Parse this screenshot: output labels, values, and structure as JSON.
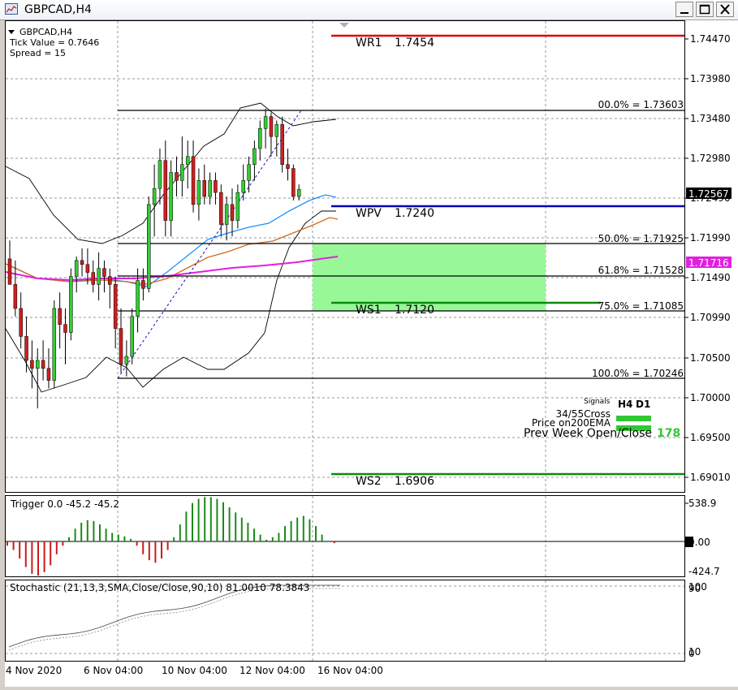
{
  "window": {
    "title": "GBPCAD,H4"
  },
  "info": {
    "symbol": "GBPCAD,H4",
    "tick_value": "Tick Value = 0.7646",
    "spread": "Spread = 15"
  },
  "price_axis": [
    "1.74470",
    "1.73980",
    "1.73480",
    "1.72980",
    "1.72490",
    "1.71990",
    "1.71490",
    "1.70990",
    "1.70500",
    "1.70000",
    "1.69500",
    "1.69010"
  ],
  "price_markers": {
    "current": "1.72567",
    "ma": "1.71716"
  },
  "pivots": {
    "wr1": {
      "name": "WR1",
      "value": "1.7454"
    },
    "wpv": {
      "name": "WPV",
      "value": "1.7240"
    },
    "ws1": {
      "name": "WS1",
      "value": "1.7120"
    },
    "ws2": {
      "name": "WS2",
      "value": "1.6906"
    }
  },
  "fibonacci": [
    {
      "label": "00.0% = 1.73603"
    },
    {
      "label": "50.0% = 1.71925"
    },
    {
      "label": "61.8% = 1.71528"
    },
    {
      "label": "75.0% = 1.71085"
    },
    {
      "label": "100.0% = 1.70246"
    }
  ],
  "signals": {
    "header": "Signals",
    "col_h4": "H4",
    "col_d1": "D1",
    "rows": [
      "34/55Cross",
      "Price on200EMA"
    ],
    "prev_week_label": "Prev Week Open/Close",
    "prev_week_value": "178"
  },
  "trigger": {
    "label": "Trigger 0.0 -45.2 -45.2",
    "axis": [
      "538.9",
      "0.00",
      "-424.7"
    ]
  },
  "stochastic": {
    "label": "Stochastic (21,13,3,SMA,Close/Close,90,10) 81.0010 78.3843",
    "axis": [
      "100",
      "90",
      "10",
      "0"
    ]
  },
  "time_axis": [
    "4 Nov 2020",
    "6 Nov 04:00",
    "10 Nov 04:00",
    "12 Nov 04:00",
    "16 Nov 04:00"
  ],
  "colors": {
    "up": "#32cd32",
    "down": "#cd1f1f",
    "wr1": "#e00000",
    "wpv": "#0000b8",
    "ws": "#0b8a0b",
    "ma_magenta": "#e020e0",
    "zone": "#98f898"
  }
}
